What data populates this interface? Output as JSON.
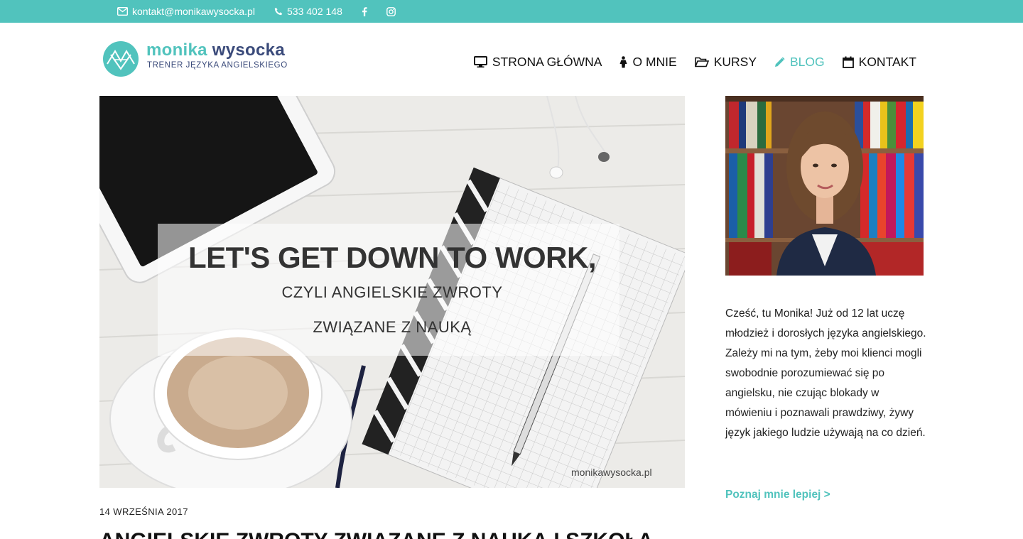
{
  "topbar": {
    "email": "kontakt@monikawysocka.pl",
    "phone": "533 402 148",
    "icons": [
      "envelope-icon",
      "phone-icon",
      "facebook-icon",
      "instagram-icon"
    ],
    "bg_color": "#51c3bd"
  },
  "logo": {
    "name_part1": "monika ",
    "name_part2": "wysocka",
    "tagline": "TRENER JĘZYKA ANGIELSKIEGO"
  },
  "nav": {
    "items": [
      {
        "label": "STRONA GŁÓWNA",
        "icon": "monitor-icon"
      },
      {
        "label": "O MNIE",
        "icon": "person-icon"
      },
      {
        "label": "KURSY",
        "icon": "folder-open-icon"
      },
      {
        "label": "BLOG",
        "icon": "pencil-icon",
        "active": true
      },
      {
        "label": "KONTAKT",
        "icon": "calendar-icon"
      }
    ],
    "active_color": "#51c3bd"
  },
  "hero": {
    "title": "LET'S GET DOWN TO WORK,",
    "subtitle1": "CZYLI ANGIELSKIE ZWROTY",
    "subtitle2": "ZWIĄZANE Z NAUKĄ",
    "watermark": "monikawysocka.pl"
  },
  "post": {
    "date": "14 WRZEŚNIA 2017",
    "title": "ANGIELSKIE ZWROTY ZWIĄZANE Z NAUKĄ I SZKOŁĄ"
  },
  "sidebar": {
    "bio": "Cześć, tu Monika! Już od 12 lat uczę młodzież i dorosłych języka angielskiego. Zależy mi na tym, żeby moi klienci mogli swobodnie porozumiewać się po angielsku, nie czując blokady w mówieniu i poznawali prawdziwy, żywy język jakiego ludzie używają na co dzień.",
    "link": "Poznaj mnie lepiej >"
  }
}
